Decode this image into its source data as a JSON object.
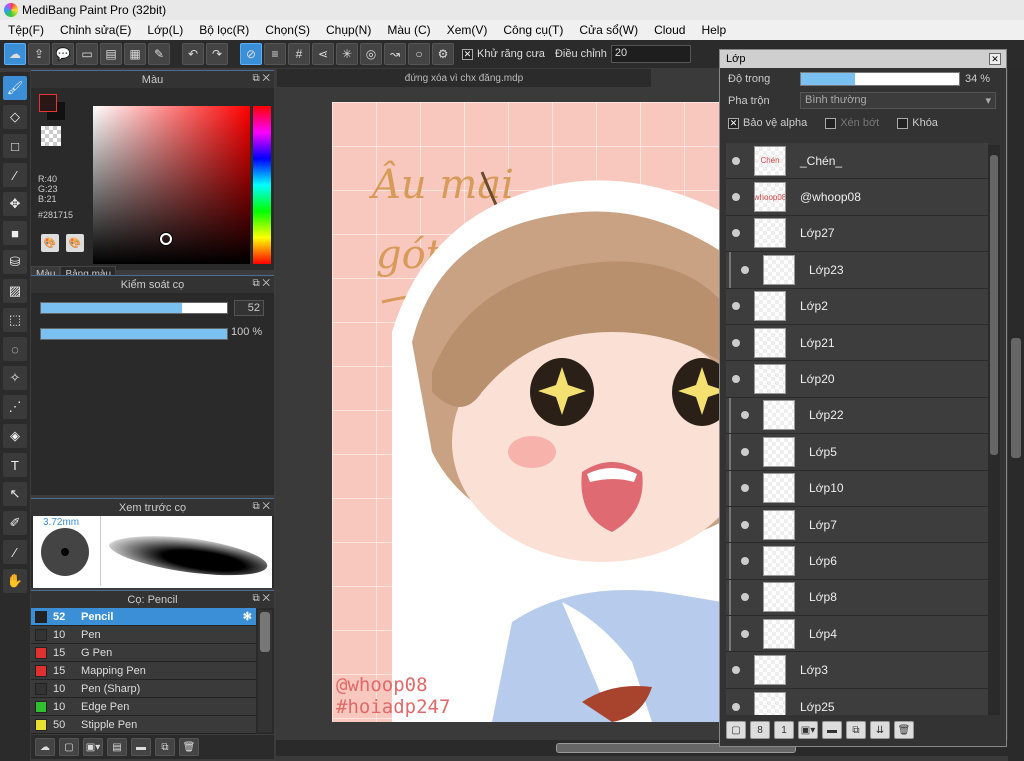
{
  "window": {
    "title": "MediBang Paint Pro (32bit)"
  },
  "menu": [
    "Tệp(F)",
    "Chỉnh sửa(E)",
    "Lớp(L)",
    "Bộ lọc(R)",
    "Chọn(S)",
    "Chụp(N)",
    "Màu (C)",
    "Xem(V)",
    "Công cụ(T)",
    "Cửa sổ(W)",
    "Cloud",
    "Help"
  ],
  "toolbar": {
    "antialias_label": "Khử răng cưa",
    "adjust_label": "Điều chỉnh",
    "adjust_value": "20"
  },
  "color_panel": {
    "title": "Màu",
    "rgb": "R:40\nG:23\nB:21",
    "hex": "#281715",
    "tabs": [
      "Màu",
      "Bảng màu"
    ],
    "fg_color": "#281715"
  },
  "brush_control": {
    "title": "Kiểm soát cọ",
    "size_value": "52",
    "size_fraction": 0.76,
    "opacity_value": "100 %",
    "opacity_fraction": 1.0
  },
  "brush_preview": {
    "title": "Xem trước cọ",
    "size_label": "3.72mm"
  },
  "brush_list": {
    "title": "Cọ: Pencil",
    "items": [
      {
        "size": "52",
        "name": "Pencil",
        "color": "#222222",
        "active": true
      },
      {
        "size": "10",
        "name": "Pen",
        "color": "#333333",
        "active": false
      },
      {
        "size": "15",
        "name": "G Pen",
        "color": "#e03030",
        "active": false
      },
      {
        "size": "15",
        "name": "Mapping Pen",
        "color": "#e03030",
        "active": false
      },
      {
        "size": "10",
        "name": "Pen (Sharp)",
        "color": "#333333",
        "active": false
      },
      {
        "size": "10",
        "name": "Edge Pen",
        "color": "#30c030",
        "active": false
      },
      {
        "size": "50",
        "name": "Stipple Pen",
        "color": "#e8e030",
        "active": false
      }
    ]
  },
  "document": {
    "tab_title": "đứng xóa vì chx đăng.mdp",
    "art_text_1": "Âu mai",
    "art_text_2": "gót",
    "signature_1": "@whoop08",
    "signature_2": "#hoiadp247"
  },
  "layer_panel": {
    "title": "Lớp",
    "opacity_label": "Độ trong",
    "opacity_value": "34 %",
    "opacity_fraction": 0.34,
    "blend_label": "Pha trộn",
    "blend_value": "Bình thường",
    "protect_alpha_label": "Bảo vệ alpha",
    "clip_label": "Xén bớt",
    "lock_label": "Khóa",
    "layers": [
      {
        "name": "_Chén_",
        "thumb": "Chén",
        "child": false
      },
      {
        "name": "@whoop08",
        "thumb": "whoop08",
        "child": false
      },
      {
        "name": "Lớp27",
        "thumb": "",
        "child": false
      },
      {
        "name": "Lớp23",
        "thumb": "",
        "child": true
      },
      {
        "name": "Lớp2",
        "thumb": "",
        "child": false
      },
      {
        "name": "Lớp21",
        "thumb": "",
        "child": false
      },
      {
        "name": "Lớp20",
        "thumb": "",
        "child": false
      },
      {
        "name": "Lớp22",
        "thumb": "",
        "child": true
      },
      {
        "name": "Lớp5",
        "thumb": "",
        "child": true
      },
      {
        "name": "Lớp10",
        "thumb": "",
        "child": true
      },
      {
        "name": "Lớp7",
        "thumb": "",
        "child": true
      },
      {
        "name": "Lớp6",
        "thumb": "",
        "child": true
      },
      {
        "name": "Lớp8",
        "thumb": "",
        "child": true
      },
      {
        "name": "Lớp4",
        "thumb": "",
        "child": true
      },
      {
        "name": "Lớp3",
        "thumb": "",
        "child": false
      },
      {
        "name": "Lớp25",
        "thumb": "",
        "child": false
      }
    ]
  }
}
